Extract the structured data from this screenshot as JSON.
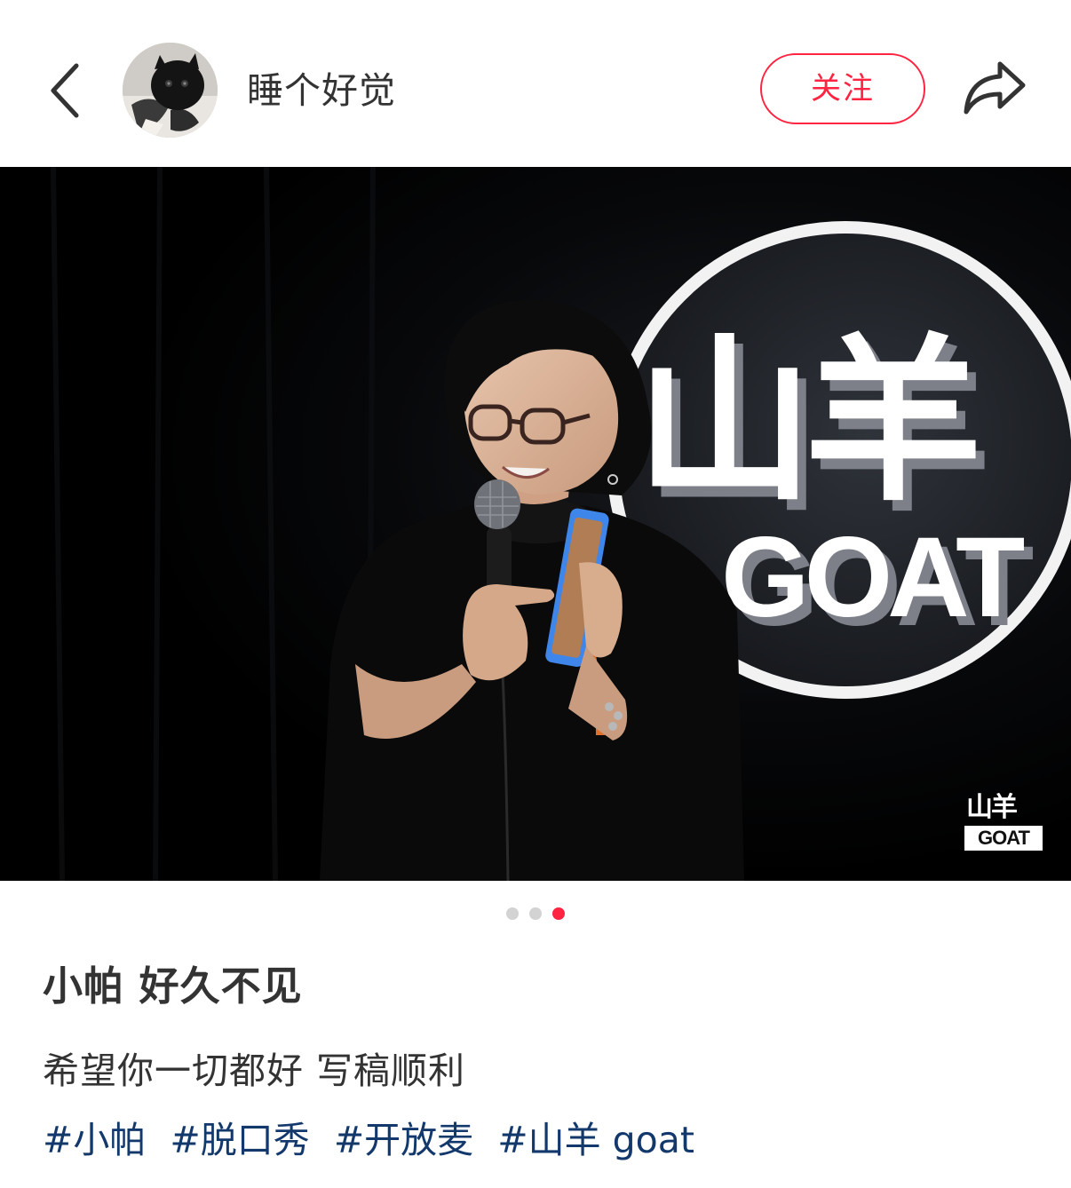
{
  "header": {
    "author_name": "睡个好觉",
    "follow_label": "关注",
    "icons": [
      "chevron-left-icon",
      "avatar-cat-photo",
      "share-arrow-icon"
    ]
  },
  "photo": {
    "sign_text_cn": "山羊",
    "sign_text_en": "GOAT",
    "watermark_cn": "山羊",
    "watermark_en": "GOAT"
  },
  "carousel": {
    "total": 3,
    "active_index": 2
  },
  "note": {
    "title": "小帕 好久不见",
    "description": "希望你一切都好 写稿顺利",
    "tags": [
      "#小帕",
      "#脱口秀",
      "#开放麦",
      "#山羊 goat"
    ]
  },
  "colors": {
    "accent": "#ff2442",
    "tag": "#13386c",
    "text": "#333333"
  }
}
